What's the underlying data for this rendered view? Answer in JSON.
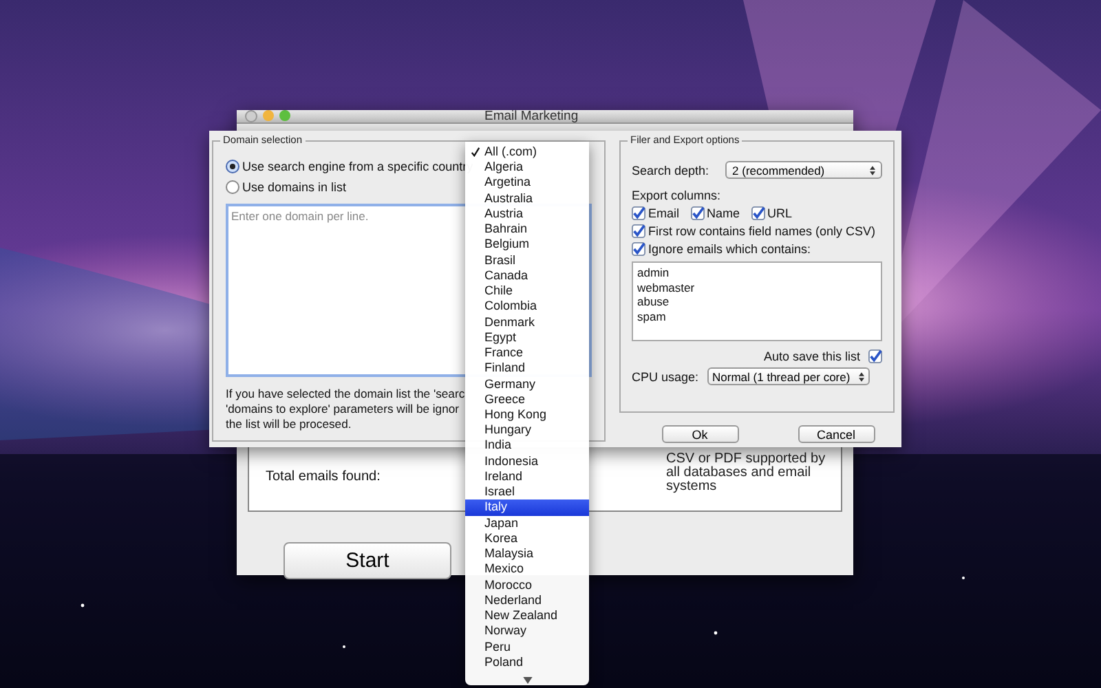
{
  "main_window": {
    "title": "Email Marketing",
    "stats_label": "Total emails found:",
    "info_lines": [
      "CSV or PDF supported by",
      "all databases and email",
      "systems"
    ],
    "start_button": "Start"
  },
  "sheet": {
    "domain_selection": {
      "legend": "Domain selection",
      "options": [
        {
          "label": "Use search engine from a specific country",
          "selected": true
        },
        {
          "label": "Use domains in list",
          "selected": false
        }
      ],
      "domains": {
        "placeholder": "Enter one domain per line."
      },
      "note_lines": [
        "If you have selected the domain list the 'searc",
        "'domains to explore' parameters will be ignor",
        "the list will be procesed."
      ]
    },
    "export_options": {
      "legend": "Filer and Export options",
      "search_depth": {
        "label": "Search depth:",
        "value": "2 (recommended)"
      },
      "export_columns_label": "Export columns:",
      "columns": [
        {
          "label": "Email",
          "checked": true
        },
        {
          "label": "Name",
          "checked": true
        },
        {
          "label": "URL",
          "checked": true
        }
      ],
      "first_row": {
        "label": "First row contains field names (only CSV)",
        "checked": true
      },
      "ignore": {
        "label": "Ignore emails which contains:",
        "checked": true
      },
      "ignore_list": [
        "admin",
        "webmaster",
        "abuse",
        "spam"
      ],
      "auto_save": {
        "label": "Auto save this list",
        "checked": true
      },
      "cpu": {
        "label": "CPU usage:",
        "value": "Normal (1 thread per core)"
      }
    },
    "buttons": [
      "Ok",
      "Cancel"
    ]
  },
  "country_menu": {
    "items": [
      {
        "label": "All (.com)",
        "checked": true,
        "selected": false
      },
      {
        "label": "Algeria",
        "checked": false,
        "selected": false
      },
      {
        "label": "Argetina",
        "checked": false,
        "selected": false
      },
      {
        "label": "Australia",
        "checked": false,
        "selected": false
      },
      {
        "label": "Austria",
        "checked": false,
        "selected": false
      },
      {
        "label": "Bahrain",
        "checked": false,
        "selected": false
      },
      {
        "label": "Belgium",
        "checked": false,
        "selected": false
      },
      {
        "label": "Brasil",
        "checked": false,
        "selected": false
      },
      {
        "label": "Canada",
        "checked": false,
        "selected": false
      },
      {
        "label": "Chile",
        "checked": false,
        "selected": false
      },
      {
        "label": "Colombia",
        "checked": false,
        "selected": false
      },
      {
        "label": "Denmark",
        "checked": false,
        "selected": false
      },
      {
        "label": "Egypt",
        "checked": false,
        "selected": false
      },
      {
        "label": "France",
        "checked": false,
        "selected": false
      },
      {
        "label": "Finland",
        "checked": false,
        "selected": false
      },
      {
        "label": "Germany",
        "checked": false,
        "selected": false
      },
      {
        "label": "Greece",
        "checked": false,
        "selected": false
      },
      {
        "label": "Hong Kong",
        "checked": false,
        "selected": false
      },
      {
        "label": "Hungary",
        "checked": false,
        "selected": false
      },
      {
        "label": "India",
        "checked": false,
        "selected": false
      },
      {
        "label": "Indonesia",
        "checked": false,
        "selected": false
      },
      {
        "label": "Ireland",
        "checked": false,
        "selected": false
      },
      {
        "label": "Israel",
        "checked": false,
        "selected": false
      },
      {
        "label": "Italy",
        "checked": false,
        "selected": true
      },
      {
        "label": "Japan",
        "checked": false,
        "selected": false
      },
      {
        "label": "Korea",
        "checked": false,
        "selected": false
      },
      {
        "label": "Malaysia",
        "checked": false,
        "selected": false
      },
      {
        "label": "Mexico",
        "checked": false,
        "selected": false
      },
      {
        "label": "Morocco",
        "checked": false,
        "selected": false
      },
      {
        "label": "Nederland",
        "checked": false,
        "selected": false
      },
      {
        "label": "New Zealand",
        "checked": false,
        "selected": false
      },
      {
        "label": "Norway",
        "checked": false,
        "selected": false
      },
      {
        "label": "Peru",
        "checked": false,
        "selected": false
      },
      {
        "label": "Poland",
        "checked": false,
        "selected": false
      }
    ]
  }
}
